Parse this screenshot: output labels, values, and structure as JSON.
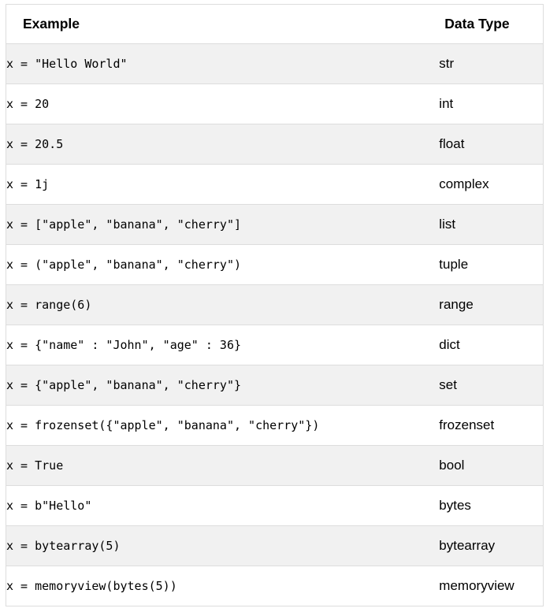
{
  "table": {
    "columns": [
      {
        "key": "example",
        "label": "Example"
      },
      {
        "key": "data_type",
        "label": "Data Type"
      }
    ],
    "rows": [
      {
        "example": "x = \"Hello World\"",
        "data_type": "str"
      },
      {
        "example": "x = 20",
        "data_type": "int"
      },
      {
        "example": "x = 20.5",
        "data_type": "float"
      },
      {
        "example": "x = 1j",
        "data_type": "complex"
      },
      {
        "example": "x = [\"apple\", \"banana\", \"cherry\"]",
        "data_type": "list"
      },
      {
        "example": "x = (\"apple\", \"banana\", \"cherry\")",
        "data_type": "tuple"
      },
      {
        "example": "x = range(6)",
        "data_type": "range"
      },
      {
        "example": "x = {\"name\" : \"John\", \"age\" : 36}",
        "data_type": "dict"
      },
      {
        "example": "x = {\"apple\", \"banana\", \"cherry\"}",
        "data_type": "set"
      },
      {
        "example": "x = frozenset({\"apple\", \"banana\", \"cherry\"})",
        "data_type": "frozenset"
      },
      {
        "example": "x = True",
        "data_type": "bool"
      },
      {
        "example": "x = b\"Hello\"",
        "data_type": "bytes"
      },
      {
        "example": "x = bytearray(5)",
        "data_type": "bytearray"
      },
      {
        "example": "x = memoryview(bytes(5))",
        "data_type": "memoryview"
      }
    ]
  },
  "colors": {
    "stripe": "#f1f1f1",
    "border": "#dddddd",
    "background": "#ffffff",
    "text": "#000000"
  }
}
